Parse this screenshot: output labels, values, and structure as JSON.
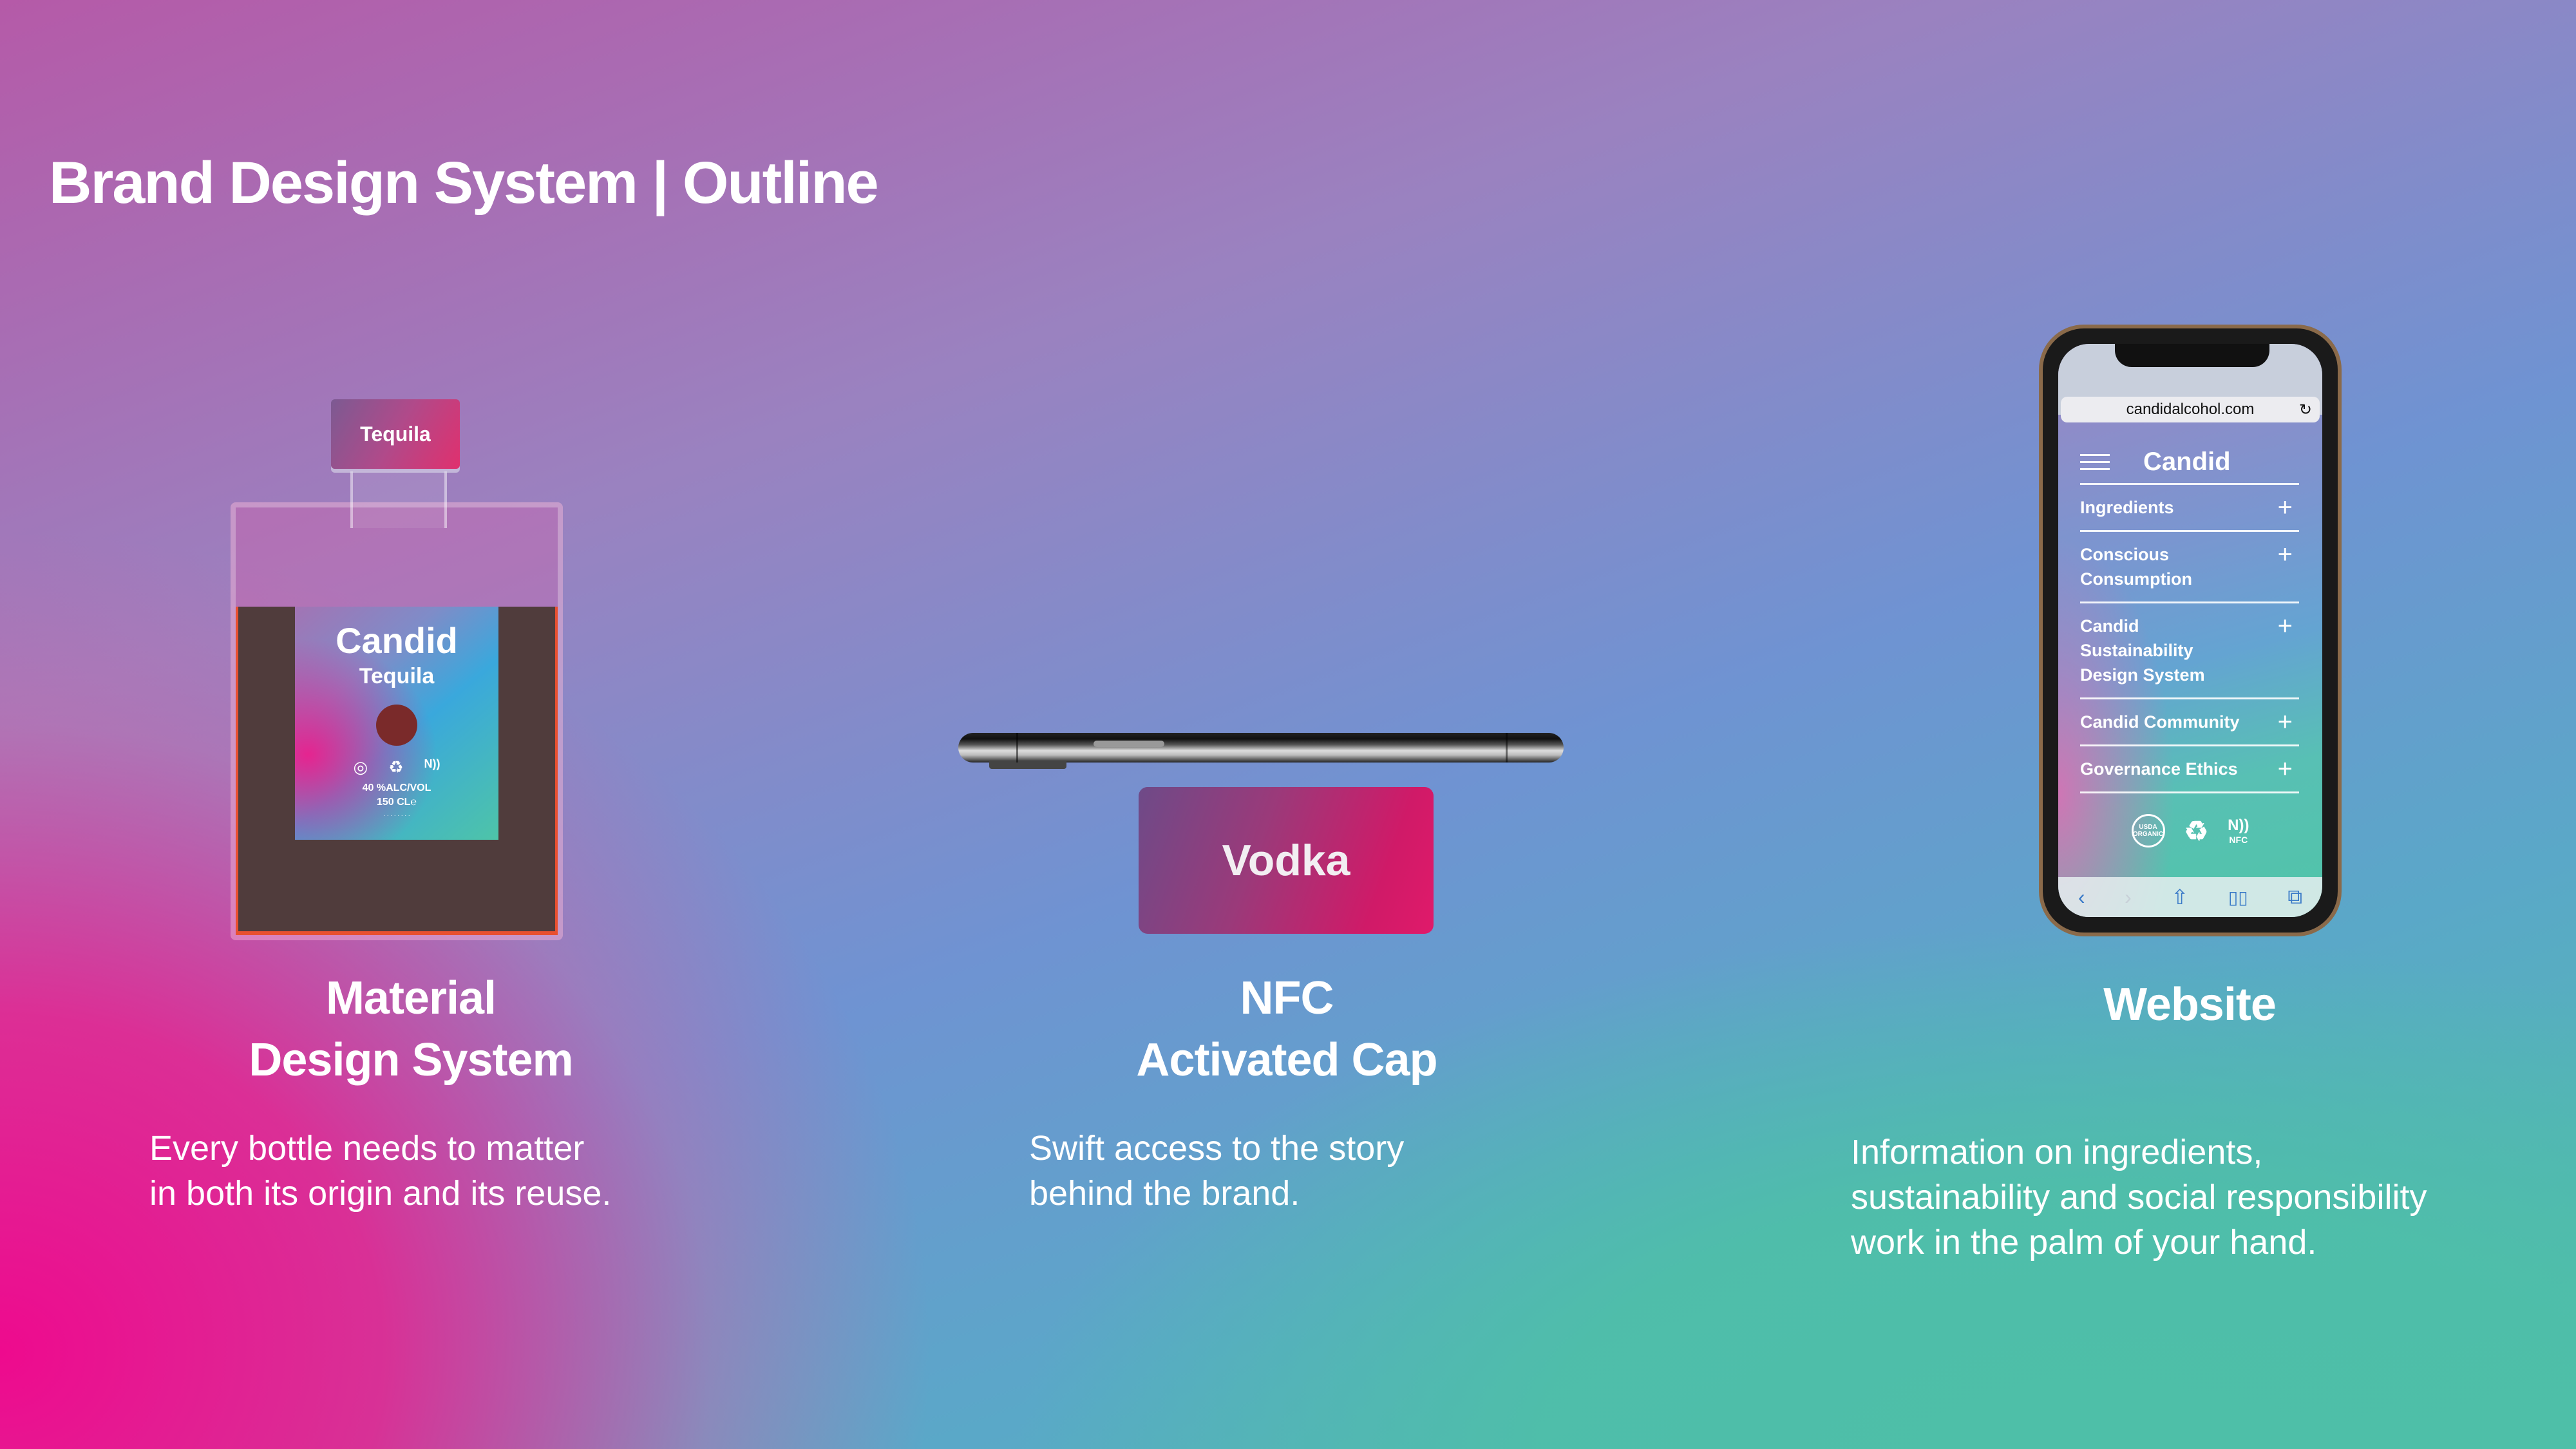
{
  "page": {
    "title": "Brand Design System | Outline",
    "background_colors": {
      "top_left": "#b55aa8",
      "top_right": "#6f93d2",
      "bottom_left": "#ee0a8e",
      "bottom_right": "#4ebfa8"
    }
  },
  "columns": [
    {
      "title_line1": "Material",
      "title_line2": "Design System",
      "desc_line1": "Every bottle needs to matter",
      "desc_line2": "in both its origin and its reuse."
    },
    {
      "title_line1": "NFC",
      "title_line2": "Activated Cap",
      "desc_line1": "Swift access to the story",
      "desc_line2": "behind the brand."
    },
    {
      "title_line1": "Website",
      "desc_line1": "Information on ingredients,",
      "desc_line2": "sustainability and social responsibility",
      "desc_line3": "work in the palm of your hand."
    }
  ],
  "bottle": {
    "cap_label": "Tequila",
    "label_brand": "Candid",
    "label_variety": "Tequila",
    "icons": [
      "usda-organic-icon",
      "recycle-icon",
      "nfc-icon"
    ],
    "recycle_glyph": "♻",
    "nfc_glyph": "N))",
    "abv": "40 %ALC/VOL",
    "volume": "150 CL℮"
  },
  "nfc_cap": {
    "label": "Vodka"
  },
  "phone": {
    "url": "candidalcohol.com",
    "reload_glyph": "↻",
    "site_logo": "Candid",
    "menu": [
      {
        "label": "Ingredients",
        "expand": "+"
      },
      {
        "label": "Conscious Consumption",
        "expand": "+"
      },
      {
        "label": "Candid Sustainability Design System",
        "expand": "+"
      },
      {
        "label": "Candid Community",
        "expand": "+"
      },
      {
        "label": "Governance Ethics",
        "expand": "+"
      }
    ],
    "badges": {
      "usda": "USDA ORGANIC",
      "recycle": "♻",
      "nfc_waves": "N))",
      "nfc_text": "NFC"
    },
    "toolbar": {
      "back": "‹",
      "forward": "›",
      "share": "⇧",
      "bookmarks": "📖",
      "tabs": "⧉"
    }
  }
}
